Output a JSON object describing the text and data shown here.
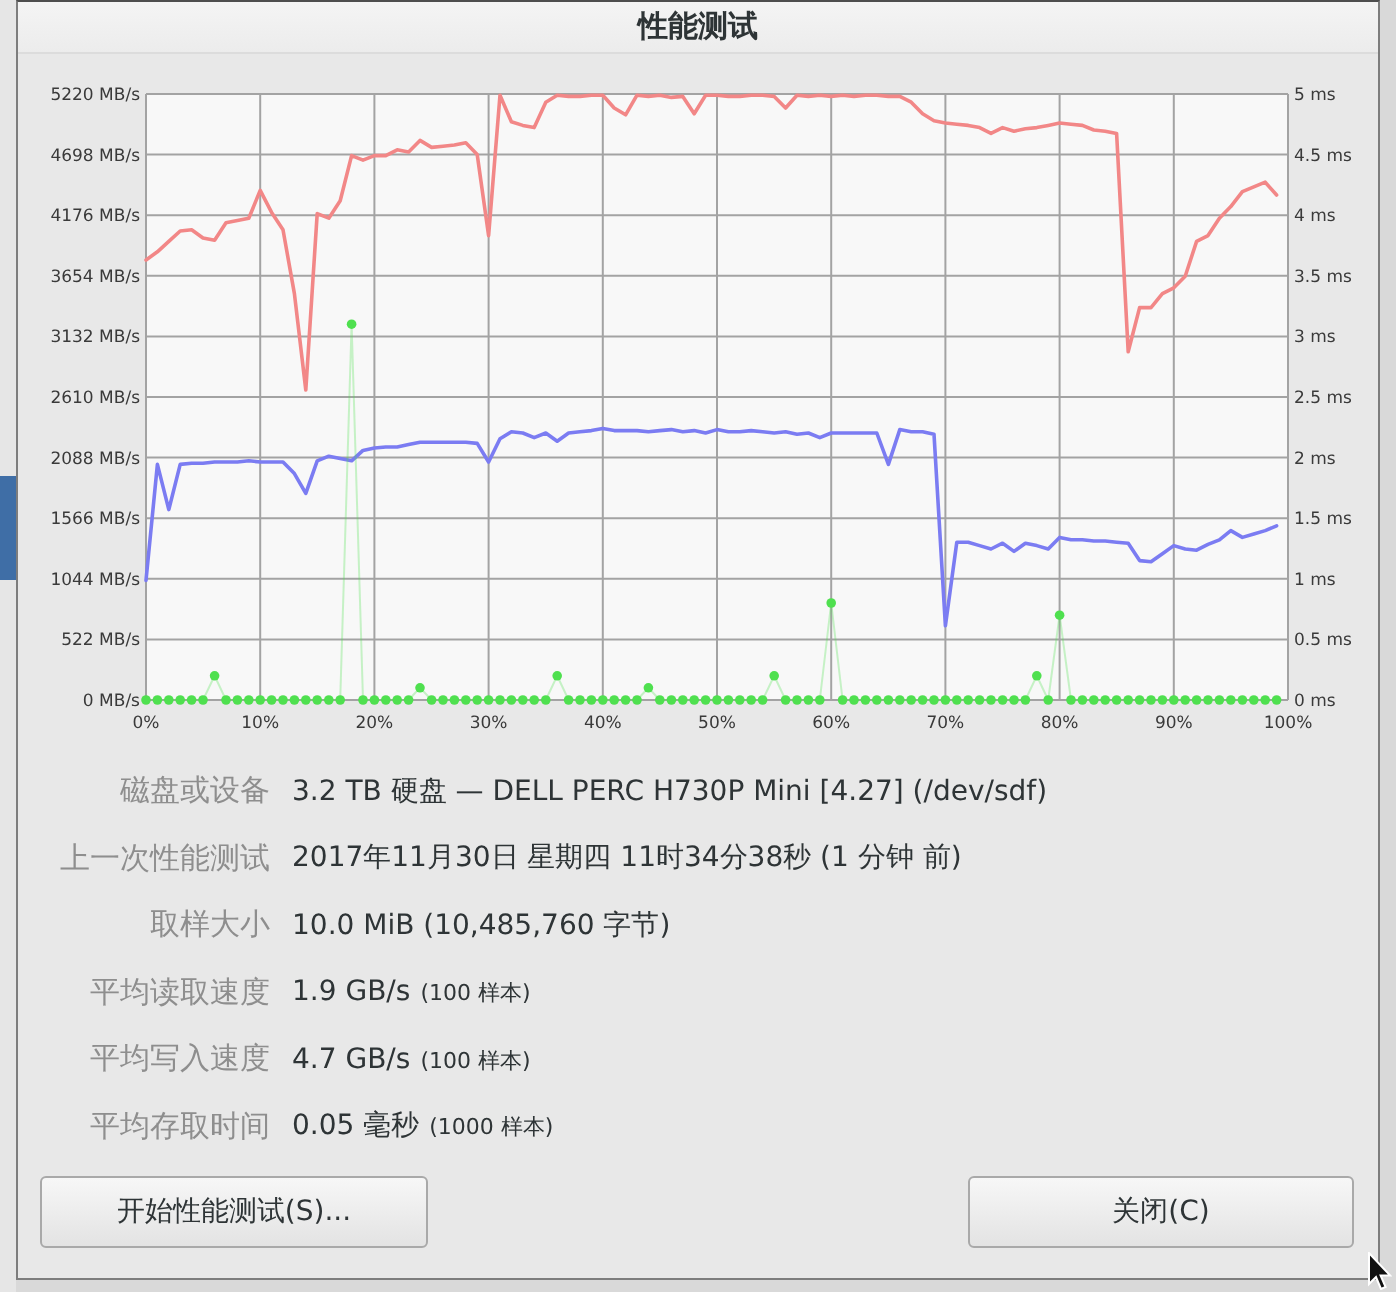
{
  "window": {
    "title": "性能测试"
  },
  "chart": {
    "chart_data": {
      "type": "line",
      "grid": true,
      "x": [
        0,
        1,
        2,
        3,
        4,
        5,
        6,
        7,
        8,
        9,
        10,
        11,
        12,
        13,
        14,
        15,
        16,
        17,
        18,
        19,
        20,
        21,
        22,
        23,
        24,
        25,
        26,
        27,
        28,
        29,
        30,
        31,
        32,
        33,
        34,
        35,
        36,
        37,
        38,
        39,
        40,
        41,
        42,
        43,
        44,
        45,
        46,
        47,
        48,
        49,
        50,
        51,
        52,
        53,
        54,
        55,
        56,
        57,
        58,
        59,
        60,
        61,
        62,
        63,
        64,
        65,
        66,
        67,
        68,
        69,
        70,
        71,
        72,
        73,
        74,
        75,
        76,
        77,
        78,
        79,
        80,
        81,
        82,
        83,
        84,
        85,
        86,
        87,
        88,
        89,
        90,
        91,
        92,
        93,
        94,
        95,
        96,
        97,
        98,
        99
      ],
      "xlim": [
        0,
        100
      ],
      "xticks": [
        {
          "value": 0,
          "label": "0%"
        },
        {
          "value": 10,
          "label": "10%"
        },
        {
          "value": 20,
          "label": "20%"
        },
        {
          "value": 30,
          "label": "30%"
        },
        {
          "value": 40,
          "label": "40%"
        },
        {
          "value": 50,
          "label": "50%"
        },
        {
          "value": 60,
          "label": "60%"
        },
        {
          "value": 70,
          "label": "70%"
        },
        {
          "value": 80,
          "label": "80%"
        },
        {
          "value": 90,
          "label": "90%"
        },
        {
          "value": 100,
          "label": "100%"
        }
      ],
      "ylim": [
        0,
        5220
      ],
      "yticks": [
        {
          "value": 0,
          "label": "0 MB/s"
        },
        {
          "value": 522,
          "label": "522 MB/s"
        },
        {
          "value": 1044,
          "label": "1044 MB/s"
        },
        {
          "value": 1566,
          "label": "1566 MB/s"
        },
        {
          "value": 2088,
          "label": "2088 MB/s"
        },
        {
          "value": 2610,
          "label": "2610 MB/s"
        },
        {
          "value": 3132,
          "label": "3132 MB/s"
        },
        {
          "value": 3654,
          "label": "3654 MB/s"
        },
        {
          "value": 4176,
          "label": "4176 MB/s"
        },
        {
          "value": 4698,
          "label": "4698 MB/s"
        },
        {
          "value": 5220,
          "label": "5220 MB/s"
        }
      ],
      "y2lim": [
        0,
        5
      ],
      "y2ticks": [
        {
          "value": 0,
          "label": "0 ms"
        },
        {
          "value": 0.5,
          "label": "0.5 ms"
        },
        {
          "value": 1,
          "label": "1 ms"
        },
        {
          "value": 1.5,
          "label": "1.5 ms"
        },
        {
          "value": 2,
          "label": "2 ms"
        },
        {
          "value": 2.5,
          "label": "2.5 ms"
        },
        {
          "value": 3,
          "label": "3 ms"
        },
        {
          "value": 3.5,
          "label": "3.5 ms"
        },
        {
          "value": 4,
          "label": "4 ms"
        },
        {
          "value": 4.5,
          "label": "4.5 ms"
        },
        {
          "value": 5,
          "label": "5 ms"
        }
      ],
      "series": [
        {
          "color": "#f28787",
          "values": [
            3790,
            3860,
            3950,
            4040,
            4050,
            3980,
            3960,
            4110,
            4130,
            4150,
            4390,
            4200,
            4050,
            3500,
            2670,
            4190,
            4150,
            4300,
            4690,
            4650,
            4690,
            4690,
            4740,
            4720,
            4820,
            4760,
            4770,
            4780,
            4800,
            4700,
            4000,
            5210,
            4980,
            4950,
            4930,
            5150,
            5210,
            5200,
            5200,
            5210,
            5210,
            5100,
            5040,
            5210,
            5200,
            5210,
            5190,
            5200,
            5050,
            5210,
            5210,
            5200,
            5200,
            5210,
            5210,
            5200,
            5100,
            5210,
            5200,
            5210,
            5200,
            5210,
            5200,
            5210,
            5210,
            5200,
            5200,
            5150,
            5050,
            4990,
            4970,
            4960,
            4950,
            4930,
            4880,
            4930,
            4900,
            4920,
            4930,
            4950,
            4970,
            4960,
            4950,
            4910,
            4900,
            4880,
            3000,
            3380,
            3380,
            3500,
            3550,
            3650,
            3950,
            4000,
            4150,
            4250,
            4380,
            4420,
            4460,
            4350
          ]
        },
        {
          "color": "#7b7cf2",
          "values": [
            1030,
            2030,
            1640,
            2030,
            2040,
            2040,
            2050,
            2050,
            2050,
            2060,
            2050,
            2050,
            2050,
            1950,
            1780,
            2060,
            2100,
            2080,
            2060,
            2150,
            2170,
            2180,
            2180,
            2200,
            2220,
            2220,
            2220,
            2220,
            2220,
            2210,
            2050,
            2250,
            2310,
            2300,
            2260,
            2300,
            2230,
            2300,
            2310,
            2320,
            2340,
            2320,
            2320,
            2320,
            2310,
            2320,
            2330,
            2310,
            2320,
            2300,
            2330,
            2310,
            2310,
            2320,
            2310,
            2300,
            2310,
            2290,
            2300,
            2260,
            2300,
            2300,
            2300,
            2300,
            2300,
            2030,
            2330,
            2310,
            2310,
            2290,
            640,
            1360,
            1360,
            1330,
            1300,
            1350,
            1280,
            1350,
            1330,
            1300,
            1400,
            1380,
            1380,
            1370,
            1370,
            1360,
            1350,
            1200,
            1190,
            1260,
            1330,
            1300,
            1290,
            1340,
            1380,
            1460,
            1400,
            1430,
            1460,
            1500
          ]
        },
        {
          "color": "#4fe04f",
          "axis": "y2",
          "marker": "circle",
          "values": [
            0,
            0,
            0,
            0,
            0,
            0,
            0.2,
            0,
            0,
            0,
            0,
            0,
            0,
            0,
            0,
            0,
            0,
            0,
            3.1,
            0,
            0,
            0,
            0,
            0,
            0.1,
            0,
            0,
            0,
            0,
            0,
            0,
            0,
            0,
            0,
            0,
            0,
            0.2,
            0,
            0,
            0,
            0,
            0,
            0,
            0,
            0.1,
            0,
            0,
            0,
            0,
            0,
            0,
            0,
            0,
            0,
            0,
            0.2,
            0,
            0,
            0,
            0,
            0.8,
            0,
            0,
            0,
            0,
            0,
            0,
            0,
            0,
            0,
            0,
            0,
            0,
            0,
            0,
            0,
            0,
            0,
            0.2,
            0,
            0.7,
            0,
            0,
            0,
            0,
            0,
            0,
            0,
            0,
            0,
            0,
            0,
            0,
            0,
            0,
            0,
            0,
            0,
            0,
            0
          ]
        }
      ]
    }
  },
  "details": [
    {
      "label": "磁盘或设备",
      "value": "3.2 TB 硬盘 — DELL PERC H730P Mini [4.27] (/dev/sdf)"
    },
    {
      "label": "上一次性能测试",
      "value": "2017年11月30日 星期四 11时34分38秒 (1 分钟 前)"
    },
    {
      "label": "取样大小",
      "value": "10.0 MiB (10,485,760 字节)"
    },
    {
      "label": "平均读取速度",
      "value": "1.9 GB/s",
      "note": "(100 样本)"
    },
    {
      "label": "平均写入速度",
      "value": "4.7 GB/s",
      "note": "(100 样本)"
    },
    {
      "label": "平均存取时间",
      "value": "0.05 毫秒",
      "note": "(1000 样本)"
    }
  ],
  "buttons": [
    {
      "label": "开始性能测试(S)..."
    },
    {
      "label": "关闭(C)"
    }
  ]
}
